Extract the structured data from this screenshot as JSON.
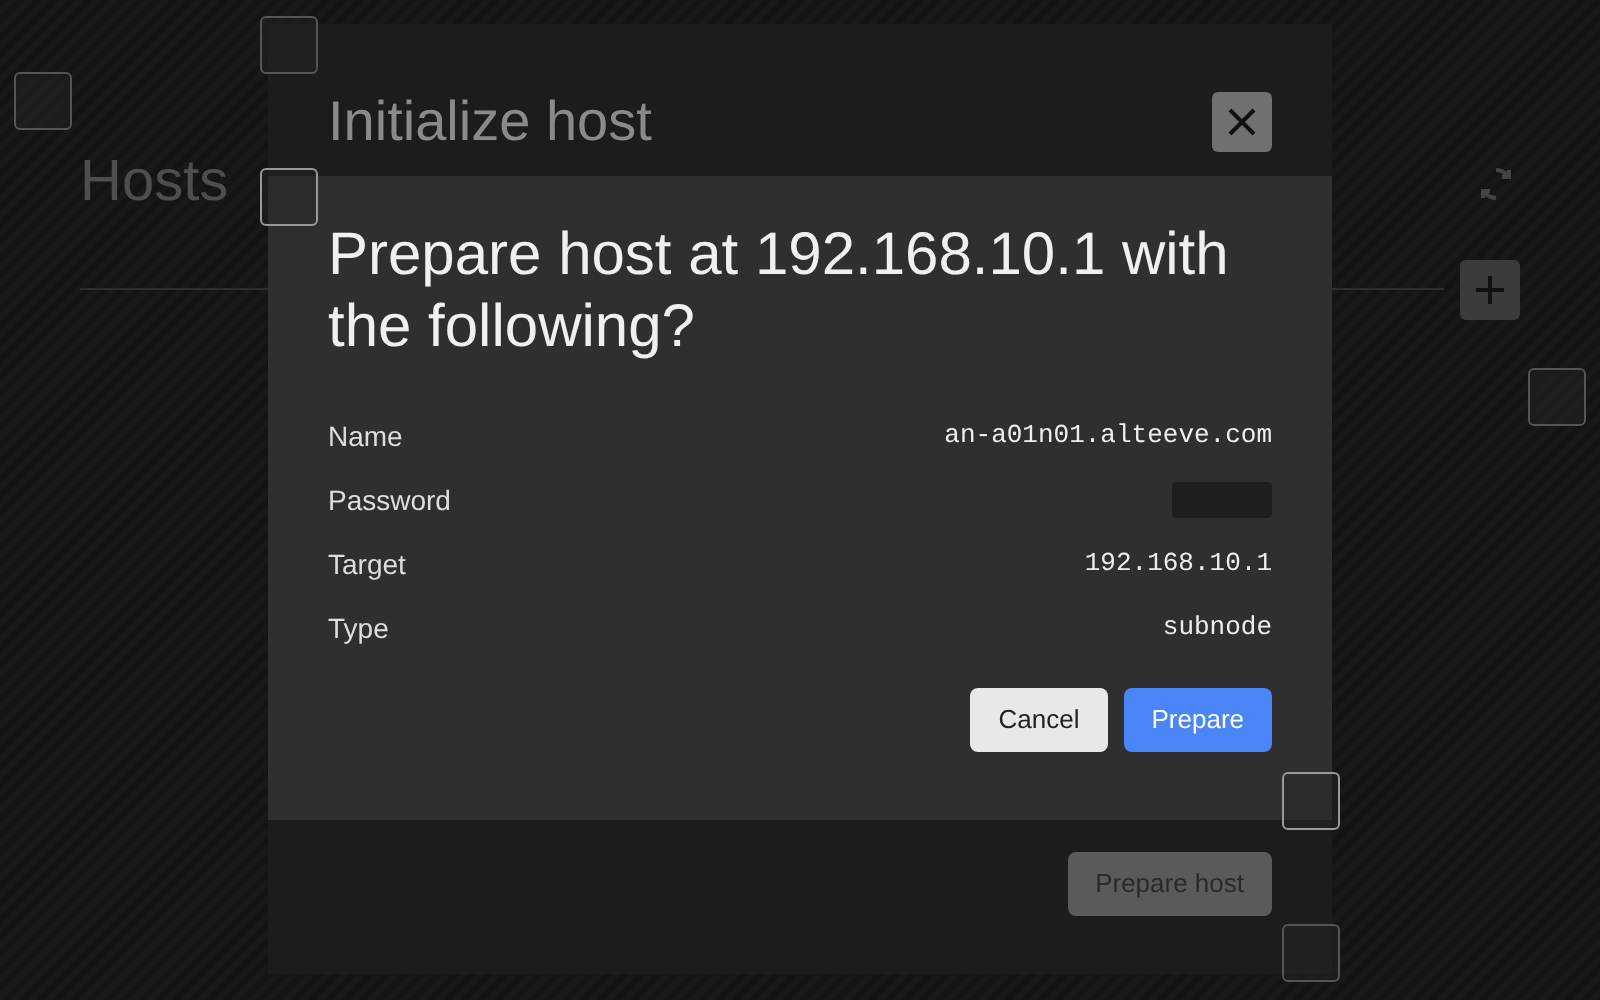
{
  "page": {
    "title": "Hosts"
  },
  "dialog": {
    "title": "Initialize host",
    "submit": {
      "label": "Prepare host",
      "disabled": true
    }
  },
  "confirm": {
    "title": "Prepare host at 192.168.10.1 with the following?",
    "rows": [
      {
        "label": "Name",
        "value": "an-a01n01.alteeve.com",
        "kind": "text"
      },
      {
        "label": "Password",
        "kind": "masked"
      },
      {
        "label": "Target",
        "value": "192.168.10.1",
        "kind": "text"
      },
      {
        "label": "Type",
        "value": "subnode",
        "kind": "text"
      }
    ],
    "buttons": [
      {
        "label": "Cancel",
        "kind": "secondary"
      },
      {
        "label": "Prepare",
        "kind": "primary"
      }
    ]
  }
}
